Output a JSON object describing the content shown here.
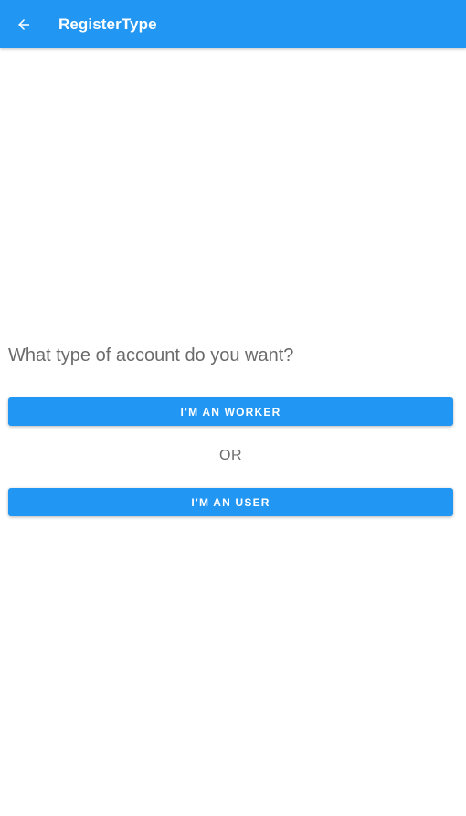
{
  "app_bar": {
    "title": "RegisterType",
    "back_icon": "arrow-left-icon",
    "color": "#2196f3"
  },
  "main": {
    "question": "What type of account do you want?",
    "worker_button_label": "I'M AN WORKER",
    "separator_text": "OR",
    "user_button_label": "I'M AN USER"
  },
  "colors": {
    "accent": "#2196f3",
    "text_secondary": "#6b6b6b",
    "button_text": "#ffffff"
  }
}
